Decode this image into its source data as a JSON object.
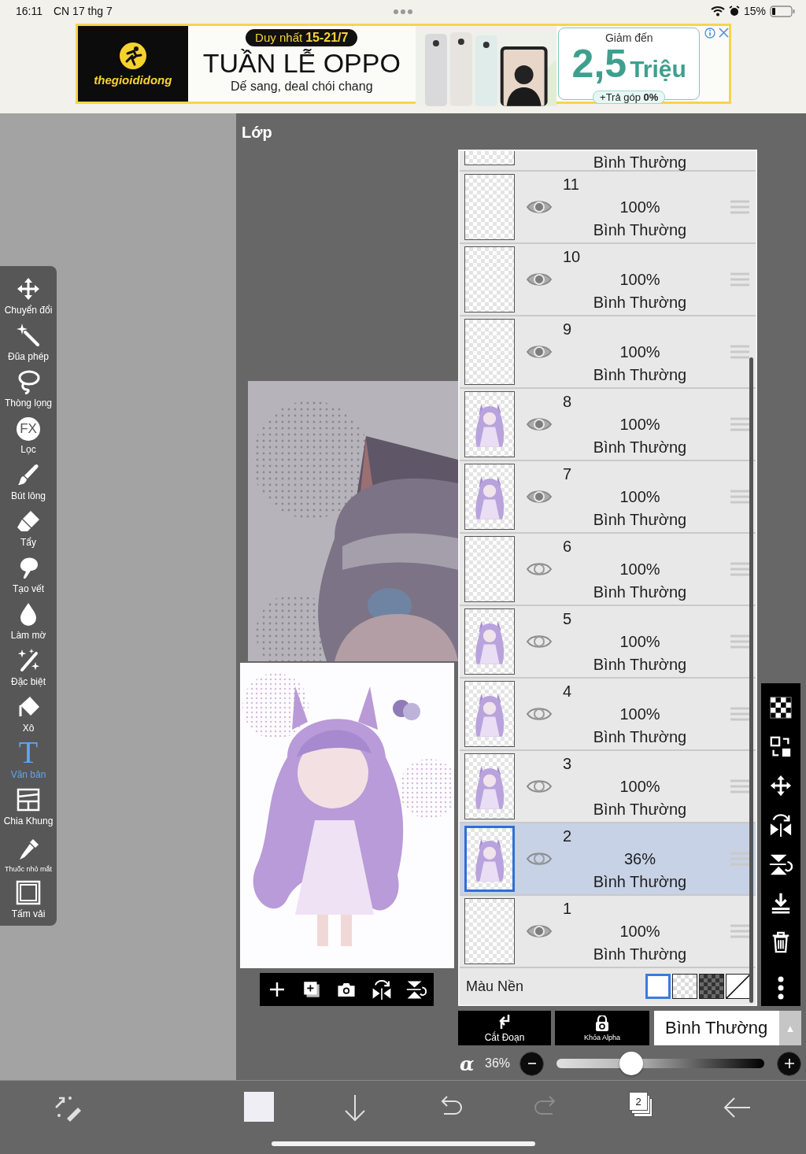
{
  "status_bar": {
    "time": "16:11",
    "date": "CN 17 thg 7",
    "battery": "15%"
  },
  "ad": {
    "brand": "thegioididong",
    "badge_lead": "Duy nhất",
    "badge_dates": "15-21/7",
    "headline": "TUẦN LỄ OPPO",
    "slogan": "Dế sang, deal chói chang",
    "offer_label": "Giảm đến",
    "offer_amount": "2,5",
    "offer_unit": "Triệu",
    "installment": "+Trả góp **0%**"
  },
  "tools": [
    {
      "kind": "move",
      "label": "Chuyển đổi",
      "selected": false
    },
    {
      "kind": "wand",
      "label": "Đũa phép",
      "selected": false
    },
    {
      "kind": "lasso",
      "label": "Thòng lọng",
      "selected": false
    },
    {
      "kind": "filter",
      "label": "Lọc",
      "icon_text": "FX",
      "selected": false
    },
    {
      "kind": "brush",
      "label": "Bút lông",
      "selected": false
    },
    {
      "kind": "eraser",
      "label": "Tẩy",
      "selected": false
    },
    {
      "kind": "smudge",
      "label": "Tạo vết",
      "selected": false
    },
    {
      "kind": "blur",
      "label": "Làm mờ",
      "selected": false
    },
    {
      "kind": "special",
      "label": "Đặc biệt",
      "selected": false
    },
    {
      "kind": "bucket",
      "label": "Xô",
      "selected": false
    },
    {
      "kind": "text",
      "label": "Văn bản",
      "icon_text": "T",
      "selected": true
    },
    {
      "kind": "frame",
      "label": "Chia Khung",
      "selected": false
    },
    {
      "kind": "eyedropper",
      "label": "Thuốc nhỏ mắt",
      "selected": false
    },
    {
      "kind": "canvas",
      "label": "Tấm vải",
      "selected": false
    }
  ],
  "panel": {
    "title": "Lớp"
  },
  "preview_tools": [
    {
      "kind": "add"
    },
    {
      "kind": "add-layer"
    },
    {
      "kind": "camera"
    },
    {
      "kind": "flip-horizontal"
    },
    {
      "kind": "flip-vertical"
    }
  ],
  "partial_layer": {
    "blend": "Bình Thường"
  },
  "layers": [
    {
      "kind": "empty",
      "name": "11",
      "opacity": "100%",
      "blend": "Bình Thường",
      "visible": true,
      "selected": false
    },
    {
      "kind": "empty",
      "name": "10",
      "opacity": "100%",
      "blend": "Bình Thường",
      "visible": true,
      "selected": false
    },
    {
      "kind": "empty",
      "name": "9",
      "opacity": "100%",
      "blend": "Bình Thường",
      "visible": true,
      "selected": false
    },
    {
      "kind": "art",
      "name": "8",
      "opacity": "100%",
      "blend": "Bình Thường",
      "visible": true,
      "selected": false
    },
    {
      "kind": "art",
      "name": "7",
      "opacity": "100%",
      "blend": "Bình Thường",
      "visible": true,
      "selected": false
    },
    {
      "kind": "empty",
      "name": "6",
      "opacity": "100%",
      "blend": "Bình Thường",
      "visible": false,
      "selected": false
    },
    {
      "kind": "art",
      "name": "5",
      "opacity": "100%",
      "blend": "Bình Thường",
      "visible": false,
      "selected": false
    },
    {
      "kind": "art",
      "name": "4",
      "opacity": "100%",
      "blend": "Bình Thường",
      "visible": false,
      "selected": false
    },
    {
      "kind": "art",
      "name": "3",
      "opacity": "100%",
      "blend": "Bình Thường",
      "visible": false,
      "selected": false
    },
    {
      "kind": "art",
      "name": "2",
      "opacity": "36%",
      "blend": "Bình Thường",
      "visible": false,
      "selected": true
    },
    {
      "kind": "empty",
      "name": "1",
      "opacity": "100%",
      "blend": "Bình Thường",
      "visible": true,
      "selected": false
    }
  ],
  "background": {
    "label": "Màu Nền",
    "swatches": [
      {
        "kind": "white",
        "selected": true
      },
      {
        "kind": "checker-light",
        "selected": false
      },
      {
        "kind": "checker-dark",
        "selected": false
      },
      {
        "kind": "none",
        "selected": false
      }
    ]
  },
  "right_tools": [
    {
      "kind": "checker"
    },
    {
      "kind": "swap"
    },
    {
      "kind": "move"
    },
    {
      "kind": "rotate-flip"
    },
    {
      "kind": "flip-vertical"
    },
    {
      "kind": "download"
    },
    {
      "kind": "trash"
    }
  ],
  "actions": [
    {
      "kind": "clip",
      "label": "Cắt Đoạn"
    },
    {
      "kind": "alpha-lock",
      "label": "Khóa Alpha"
    }
  ],
  "blend_mode": {
    "value": "Bình Thường",
    "arrow": "▲"
  },
  "alpha": {
    "symbol": "α",
    "reading": "36%",
    "level": 0.36
  },
  "bottom_bar": [
    {
      "kind": "transform",
      "disabled": false
    },
    {
      "kind": "color",
      "disabled": false
    },
    {
      "kind": "down",
      "disabled": false
    },
    {
      "kind": "undo",
      "disabled": false
    },
    {
      "kind": "redo",
      "disabled": true
    },
    {
      "kind": "layers",
      "label": "2",
      "disabled": false
    },
    {
      "kind": "back",
      "disabled": false
    }
  ]
}
